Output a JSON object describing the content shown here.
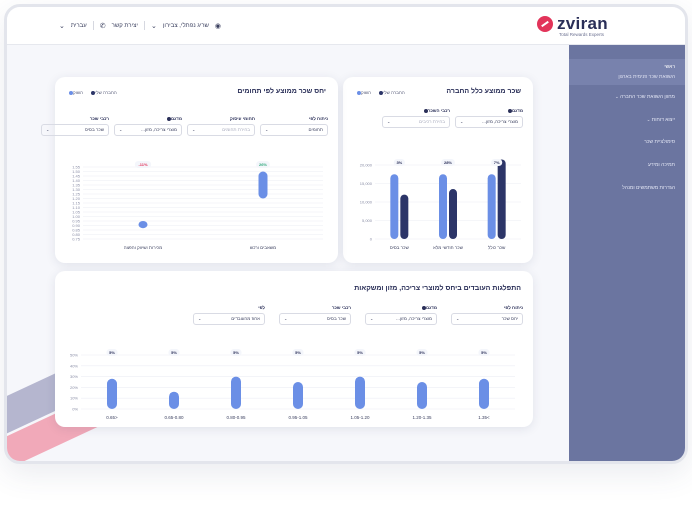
{
  "brand": {
    "name": "zviran",
    "tagline": "Total Rewards Experts"
  },
  "topnav": {
    "language": "עברית",
    "contact": "יצירת קשר",
    "user": "שריג נפתלי, צבירון"
  },
  "sidebar": {
    "items": [
      {
        "label": "ראשי",
        "sub": "השוואת שכר פנימית בארגון",
        "active": true,
        "chevron": false
      },
      {
        "label": "מחוון השוואת שכר החברה",
        "active": false,
        "chevron": true
      },
      {
        "label": "ייצוא דוחות",
        "active": false,
        "chevron": true
      },
      {
        "label": "סימולציית שכר",
        "active": false,
        "chevron": false
      },
      {
        "label": "תמיכה ומידע",
        "active": false,
        "chevron": false
      },
      {
        "label": "הגדרות משתמשים ומנהל",
        "active": false,
        "chevron": false
      }
    ]
  },
  "colors": {
    "light_bar": "#6b8fe6",
    "dark_bar": "#2c3568",
    "sidebar": "#6b75a0",
    "accent": "#e2345a",
    "positive": "#2fa87a"
  },
  "card1": {
    "title": "שכר ממוצע כלל החברה",
    "legend": {
      "company": "החברה שלי",
      "market": "השוק"
    },
    "filters": [
      {
        "label": "מדגם",
        "value": "מוצרי צריכה, מזון...",
        "placeholder": false,
        "info": true
      },
      {
        "label": "רכבי השכר",
        "value": "בחירת רכיבים",
        "placeholder": true,
        "info": true
      }
    ]
  },
  "card2": {
    "title": "יחס שכר ממוצע לפי תחומים",
    "legend": {
      "company": "החברה שלי",
      "market": "השוק"
    },
    "filters": [
      {
        "label": "ניתוח לפי",
        "value": "תחומים",
        "placeholder": false,
        "info": false
      },
      {
        "label": "תחומי עיסוק",
        "value": "בחירת תחומים",
        "placeholder": true,
        "info": false
      },
      {
        "label": "מדגם",
        "value": "מוצרי צריכה, מזון...",
        "placeholder": false,
        "info": true
      },
      {
        "label": "רכבי שכר",
        "value": "שכר בסיס",
        "placeholder": false,
        "info": false
      }
    ]
  },
  "card3": {
    "title": "התפלגות העובדים ביחס למוצרי צריכה, מזון ומשקאות",
    "filters": [
      {
        "label": "ניתוח לפי",
        "value": "יחס שכר",
        "placeholder": false,
        "info": false
      },
      {
        "label": "מדגם",
        "value": "מוצרי צריכה, מזון...",
        "placeholder": false,
        "info": true
      },
      {
        "label": "רכבי שכר",
        "value": "שכר בסיס",
        "placeholder": false,
        "info": false
      },
      {
        "label": "לפי",
        "value": "אחוז מהעובדים",
        "placeholder": false,
        "info": false
      }
    ]
  },
  "chart_data": [
    {
      "type": "bar",
      "title": "שכר ממוצע כלל החברה",
      "categories": [
        "שכר כולל",
        "שכר חודשי מלא",
        "שכר בסיס"
      ],
      "series": [
        {
          "name": "החברה שלי",
          "values": [
            21500,
            13500,
            12000
          ]
        },
        {
          "name": "השוק",
          "values": [
            17500,
            17500,
            17500
          ]
        }
      ],
      "badges": [
        "7%",
        "28%",
        "3%"
      ],
      "yticks": [
        0,
        5000,
        10000,
        15000,
        20000
      ],
      "ytick_labels": [
        "0",
        "5,000",
        "10,000",
        "15,000",
        "20,000"
      ],
      "ylim": [
        0,
        20000
      ]
    },
    {
      "type": "range",
      "title": "יחס שכר ממוצע לפי תחומים",
      "categories": [
        "משאבים ורכש",
        "מכירות ושיווק והפצה"
      ],
      "ranges": [
        [
          1.2,
          1.5
        ],
        [
          0.87,
          0.95
        ]
      ],
      "badges": [
        "26%",
        "-11%"
      ],
      "badge_colors": [
        "#2fa87a",
        "#e2345a"
      ],
      "yticks": [
        0.75,
        0.8,
        0.85,
        0.9,
        0.95,
        1.0,
        1.05,
        1.1,
        1.15,
        1.2,
        1.25,
        1.3,
        1.35,
        1.4,
        1.45,
        1.5,
        1.55
      ],
      "ylim": [
        0.75,
        1.55
      ]
    },
    {
      "type": "bar",
      "title": "התפלגות העובדים ביחס למוצרי צריכה, מזון ומשקאות",
      "categories": [
        "1.35<",
        "1.20-1.35",
        "1.05-1.20",
        "0.95-1.05",
        "0.80-0.95",
        "0.65-0.80",
        "0.65>"
      ],
      "values": [
        28,
        25,
        30,
        25,
        30,
        16,
        28
      ],
      "badges": [
        "5%",
        "5%",
        "5%",
        "5%",
        "5%",
        "5%",
        "5%"
      ],
      "yticks": [
        0,
        10,
        20,
        30,
        40,
        50
      ],
      "ytick_labels": [
        "0%",
        "10%",
        "20%",
        "30%",
        "40%",
        "50%"
      ],
      "ylim": [
        0,
        50
      ]
    }
  ]
}
